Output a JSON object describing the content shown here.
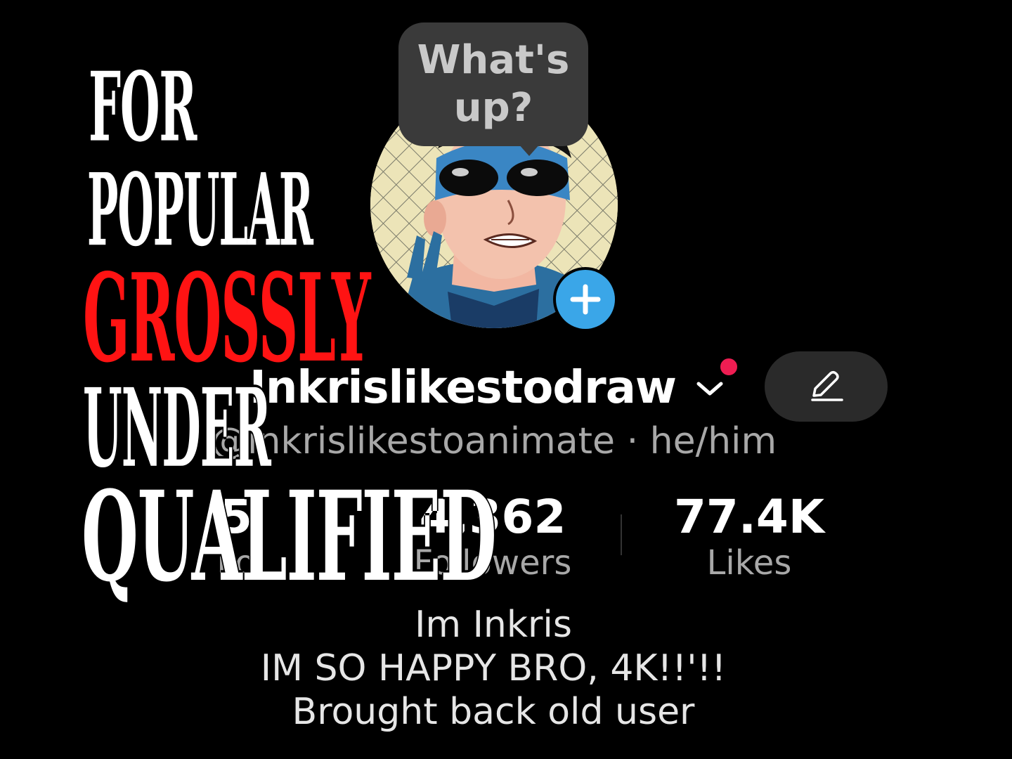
{
  "bubble": {
    "line1": "What's",
    "line2": "up?"
  },
  "profile": {
    "display_name": "Inkrislikestodraw",
    "handle": "@inkrislikestoanimate · he/him"
  },
  "stats": {
    "following": {
      "value": "5",
      "label": "Fo"
    },
    "followers": {
      "value": "4,362",
      "label": "Followers"
    },
    "likes": {
      "value": "77.4K",
      "label": "Likes"
    }
  },
  "bio": {
    "line1": "Im Inkris",
    "line2": "IM SO HAPPY BRO, 4K!!'!!",
    "line3": "Brought back old user"
  },
  "caption": {
    "line1": "FOR",
    "line2": "POPULAR",
    "line3": "GROSSLY",
    "line4": "UNDER",
    "line5": "QUALIFIED"
  },
  "icons": {
    "add": "plus-icon",
    "edit": "pencil-icon",
    "dropdown": "chevron-down-icon"
  },
  "colors": {
    "background": "#000000",
    "accent_blue": "#3aa6e8",
    "notification_red": "#ee1d52",
    "caption_red": "#ff1313"
  }
}
